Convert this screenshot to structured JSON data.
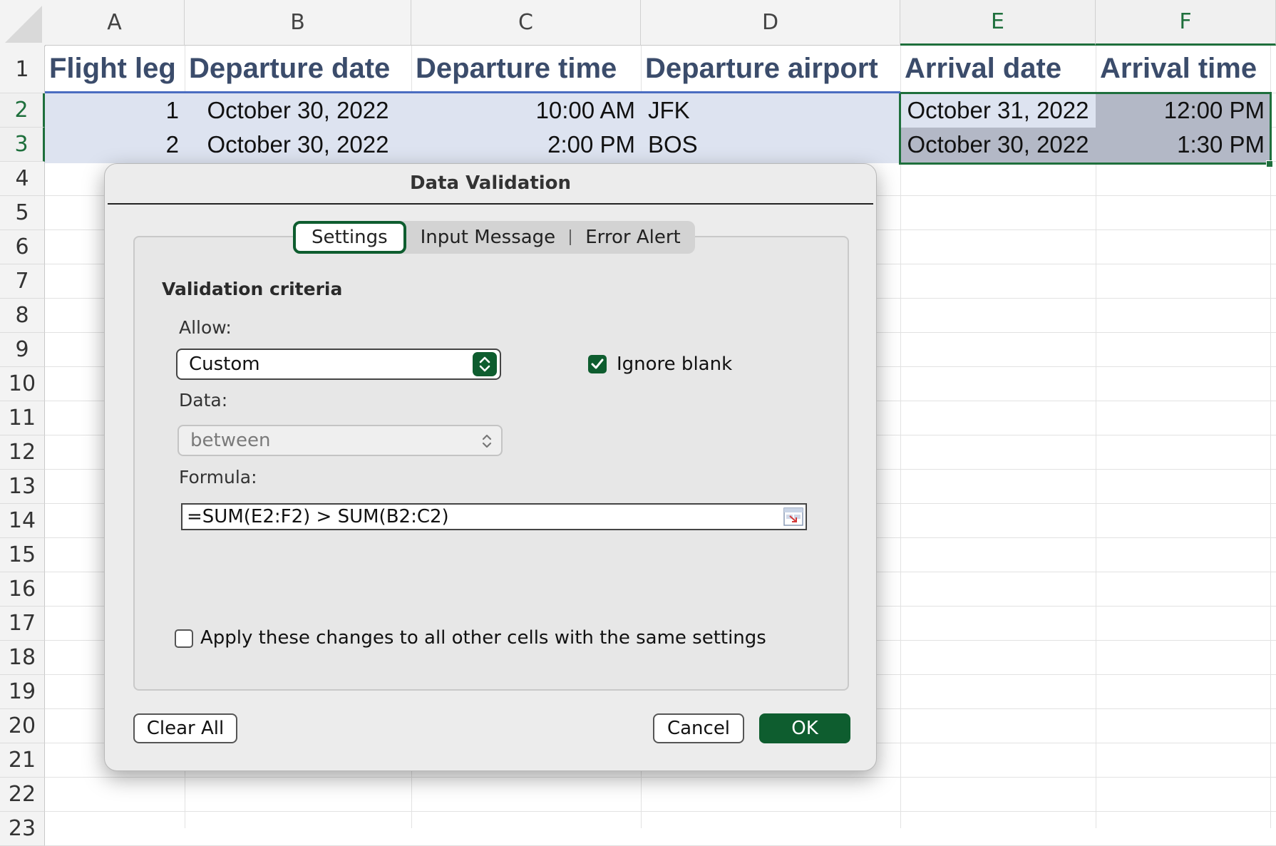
{
  "sheet": {
    "columns": [
      "A",
      "B",
      "C",
      "D",
      "E",
      "F"
    ],
    "rows": [
      "1",
      "2",
      "3",
      "4",
      "5",
      "6",
      "7",
      "8",
      "9",
      "10",
      "11",
      "12",
      "13",
      "14",
      "15",
      "16",
      "17",
      "18",
      "19",
      "20",
      "21",
      "22",
      "23"
    ],
    "headers": [
      "Flight leg",
      "Departure date",
      "Departure time",
      "Departure airport",
      "Arrival date",
      "Arrival time"
    ],
    "data": [
      [
        "1",
        "October 30, 2022",
        "10:00 AM",
        "JFK",
        "October 31, 2022",
        "12:00 PM"
      ],
      [
        "2",
        "October 30, 2022",
        "2:00 PM",
        "BOS",
        "October 30, 2022",
        "1:30 PM"
      ]
    ],
    "selected_columns": [
      "E",
      "F"
    ],
    "selected_rows": [
      "2",
      "3"
    ]
  },
  "dialog": {
    "title": "Data Validation",
    "tabs": [
      "Settings",
      "Input Message",
      "Error Alert"
    ],
    "active_tab": "Settings",
    "section_title": "Validation criteria",
    "allow_label": "Allow:",
    "allow_value": "Custom",
    "ignore_blank_label": "Ignore blank",
    "ignore_blank_checked": true,
    "data_label": "Data:",
    "data_value": "between",
    "formula_label": "Formula:",
    "formula_value": "=SUM(E2:F2) > SUM(B2:C2)",
    "apply_label": "Apply these changes to all other cells with the same settings",
    "apply_checked": false,
    "buttons": {
      "clear_all": "Clear All",
      "cancel": "Cancel",
      "ok": "OK"
    }
  },
  "colors": {
    "accent": "#0e5d2f",
    "header_text": "#3b4c6b",
    "selection_fill": "#dde3f0",
    "selected_cell_fill": "#b3b8c6"
  }
}
